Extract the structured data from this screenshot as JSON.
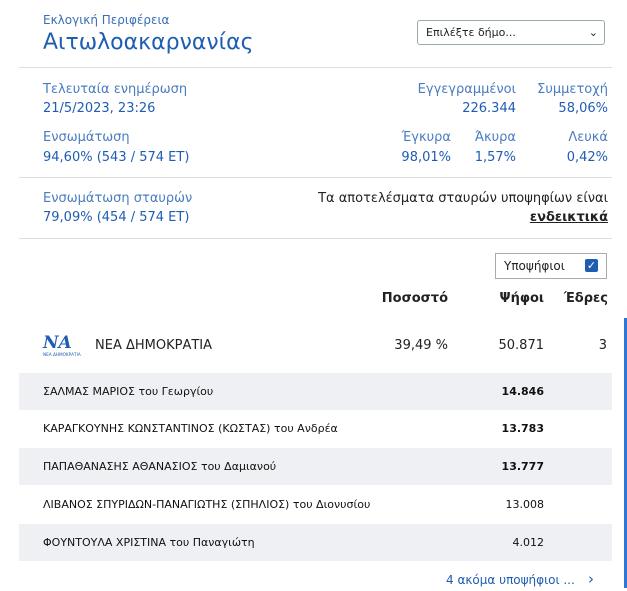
{
  "header": {
    "region_label": "Εκλογική Περιφέρεια",
    "region_name": "Αιτωλοακαρνανίας",
    "municipality_select": "Επιλέξτε δήμο..."
  },
  "stats": {
    "last_update_label": "Τελευταία ενημέρωση",
    "last_update_value": "21/5/2023, 23:26",
    "registered_label": "Εγγεγραμμένοι",
    "registered_value": "226.344",
    "turnout_label": "Συμμετοχή",
    "turnout_value": "58,06%",
    "integration_label": "Ενσωμάτωση",
    "integration_value": "94,60% (543 / 574 ΕΤ)",
    "valid_label": "Έγκυρα",
    "valid_value": "98,01%",
    "invalid_label": "Άκυρα",
    "invalid_value": "1,57%",
    "blank_label": "Λευκά",
    "blank_value": "0,42%"
  },
  "crosses": {
    "label": "Ενσωμάτωση σταυρών",
    "value": "79,09% (454 / 574 ΕΤ)",
    "note": "Τα αποτελέσματα σταυρών υποψηφίων είναι",
    "note_link": "ενδεικτικά"
  },
  "table": {
    "candidates_toggle": "Υποψήφιοι",
    "col_percent": "Ποσοστό",
    "col_votes": "Ψήφοι",
    "col_seats": "Έδρες",
    "party": {
      "logo_text": "ΝΑ",
      "logo_sub": "ΝΕΑ ΔΗΜΟΚΡΑΤΙΑ",
      "name": "ΝΕΑ ΔΗΜΟΚΡΑΤΙΑ",
      "percent": "39,49 %",
      "votes": "50.871",
      "seats": "3"
    },
    "candidates": [
      {
        "name": "ΣΑΛΜΑΣ ΜΑΡΙΟΣ του Γεωργίου",
        "votes": "14.846"
      },
      {
        "name": "ΚΑΡΑΓΚΟΥΝΗΣ ΚΩΝΣΤΑΝΤΙΝΟΣ (ΚΩΣΤΑΣ) του Ανδρέα",
        "votes": "13.783"
      },
      {
        "name": "ΠΑΠΑΘΑΝΑΣΗΣ ΑΘΑΝΑΣΙΟΣ του Δαμιανού",
        "votes": "13.777"
      },
      {
        "name": "ΛΙΒΑΝΟΣ ΣΠΥΡΙΔΩΝ-ΠΑΝΑΓΙΩΤΗΣ (ΣΠΗΛΙΟΣ) του Διονυσίου",
        "votes": "13.008"
      },
      {
        "name": "ΦΟΥΝΤΟΥΛΑ ΧΡΙΣΤΙΝΑ του Παναγιώτη",
        "votes": "4.012"
      }
    ],
    "more_candidates": "4 ακόμα υποψήφιοι ..."
  }
}
